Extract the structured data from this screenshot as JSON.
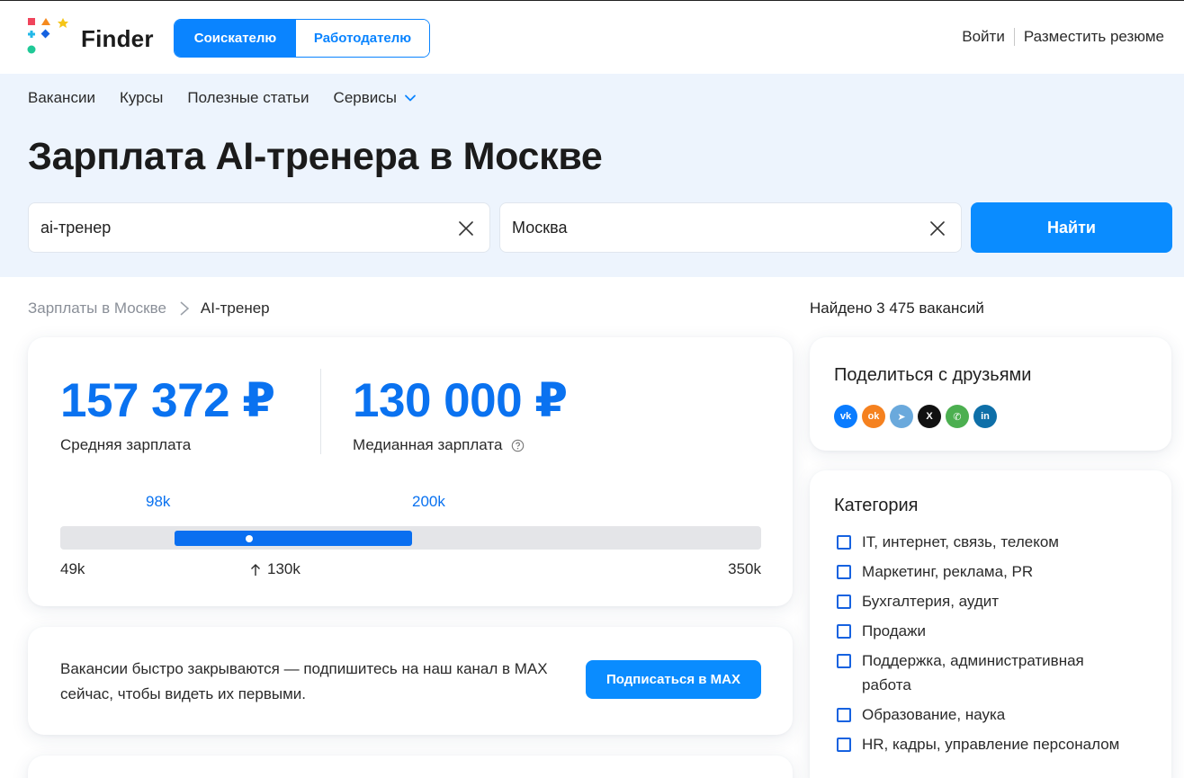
{
  "header": {
    "logo_text": "Finder",
    "roles": [
      "Соискателю",
      "Работодателю"
    ],
    "login": "Войти",
    "post_resume": "Разместить резюме"
  },
  "nav": {
    "items": [
      "Вакансии",
      "Курсы",
      "Полезные статьи",
      "Сервисы"
    ]
  },
  "page_title": "Зарплата AI-тренера в Москве",
  "search": {
    "query_value": "ai-тренер",
    "city_value": "Москва",
    "button": "Найти"
  },
  "breadcrumb": {
    "parent": "Зарплаты в Москве",
    "current": "AI-тренер"
  },
  "found_text": "Найдено 3 475 вакансий",
  "salary": {
    "average": "157 372 ₽",
    "average_label": "Средняя зарплата",
    "median": "130 000 ₽",
    "median_label": "Медианная зарплата",
    "range_low_label": "98k",
    "range_high_label": "200k",
    "min_label": "49k",
    "median_short": "130k",
    "max_label": "350k",
    "min": 49,
    "max": 350,
    "range_low": 98,
    "range_high": 200,
    "median_value": 130
  },
  "promo": {
    "text": "Вакансии быстро закрываются — подпишитесь на наш канал в MAX сейчас, чтобы видеть их первыми.",
    "button": "Подписаться в MAX"
  },
  "share": {
    "title": "Поделиться с друзьями",
    "networks": [
      {
        "icon": "vk-icon",
        "glyph": "vk",
        "color": "#0a7cff"
      },
      {
        "icon": "odnoklassniki-icon",
        "glyph": "ok",
        "color": "#f5811f"
      },
      {
        "icon": "telegram-icon",
        "glyph": "➤",
        "color": "#6aa9dc"
      },
      {
        "icon": "x-icon",
        "glyph": "X",
        "color": "#111111"
      },
      {
        "icon": "whatsapp-icon",
        "glyph": "✆",
        "color": "#4caf50"
      },
      {
        "icon": "linkedin-icon",
        "glyph": "in",
        "color": "#0e6fa8"
      }
    ]
  },
  "category": {
    "title": "Категория",
    "items": [
      "IT, интернет, связь, телеком",
      "Маркетинг, реклама, PR",
      "Бухгалтерия, аудит",
      "Продажи",
      "Поддержка, административная работа",
      "Образование, наука",
      "HR, кадры, управление персоналом"
    ]
  },
  "colors": {
    "accent": "#0a8cff",
    "salary_blue": "#0a72f0",
    "hero_bg": "#edf4fd",
    "track": "#e4e5e8"
  }
}
